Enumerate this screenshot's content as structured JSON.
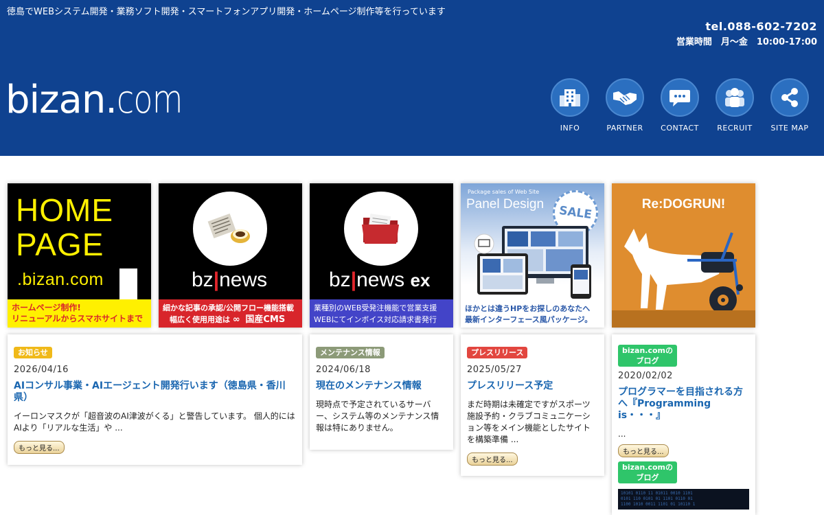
{
  "header": {
    "tagline": "徳島でWEBシステム開発・業務ソフト開発・スマートフォンアプリ開発・ホームページ制作等を行っています",
    "tel": "tel.088-602-7202",
    "hours": "営業時間　月～金　10:00-17:00",
    "logo_main": "bizan.",
    "logo_suffix": "com",
    "nav": [
      {
        "label": "INFO",
        "icon": "building-icon"
      },
      {
        "label": "PARTNER",
        "icon": "handshake-icon"
      },
      {
        "label": "CONTACT",
        "icon": "chat-bubble-icon"
      },
      {
        "label": "RECRUIT",
        "icon": "people-icon"
      },
      {
        "label": "SITE MAP",
        "icon": "share-icon"
      }
    ]
  },
  "banners": {
    "homepage": {
      "line1": "HOME",
      "line2": "PAGE",
      "brand": ".bizan.com",
      "caption1": "ホームページ制作!",
      "caption2": "リニューアルからスマホサイトまで"
    },
    "bznews": {
      "logo_a": "bz",
      "logo_b": "news",
      "caption1": "細かな記事の承認/公開フロー機能搭載",
      "caption2a": "幅広く使用用途は",
      "caption2b": "∞",
      "caption2c": "国産CMS"
    },
    "bznewsex": {
      "logo_a": "bz",
      "logo_b": "news",
      "logo_c": "ex",
      "caption1": "業種別のWEB受発注機能で営業支援",
      "caption2": "WEBにてインボイス対応請求書発行"
    },
    "paneldesign": {
      "small": "Package sales of Web Site",
      "title": "Panel Design",
      "sale": "SALE",
      "caption1": "ほかとは違うHPをお探しのあなたへ",
      "caption2": "最新インターフェース風パッケージ。"
    },
    "redogrun": {
      "title": "Re:DOGRUN!"
    }
  },
  "cards": [
    {
      "badge": "お知らせ",
      "date": "2026/04/16",
      "title": "AIコンサル事業・AIエージェント開発行います（徳島県・香川県）",
      "body": "イーロンマスクが「超音波のAI津波がくる」と警告しています。 個人的にはAIより「リアルな生活」や ...",
      "more": "もっと見る..."
    },
    {
      "badge": "メンテナンス情報",
      "date": "2024/06/18",
      "title": "現在のメンテナンス情報",
      "body": "現時点で予定されているサーバー、システム等のメンテナンス情報は特にありません。"
    },
    {
      "badge": "プレスリリース",
      "date": "2025/05/27",
      "title": "プレスリリース予定",
      "body": "まだ時期は未確定ですがスポーツ施設予約・クラブコミュニケーション等をメイン機能としたサイトを構築準備 ...",
      "more": "もっと見る..."
    },
    {
      "badge_line1": "bizan.comの",
      "badge_line2": "ブログ",
      "date": "2020/02/02",
      "title": "プログラマーを目指される方へ『Programming is・・・』",
      "body": "...",
      "more": "もっと見る...",
      "badge2_line1": "bizan.comの",
      "badge2_line2": "ブログ"
    }
  ],
  "colors": {
    "header_bg": "#0f4290",
    "link_blue": "#1a66b0",
    "badge_notice": "#f0b919",
    "badge_maintenance": "#8c9a78",
    "badge_press": "#e2463f",
    "badge_blog": "#2fc56a"
  }
}
